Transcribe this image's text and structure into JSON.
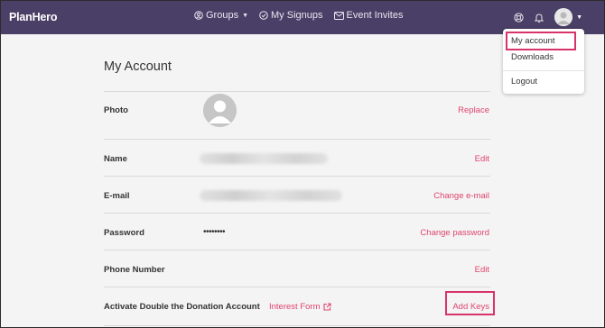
{
  "brand": "PlanHero",
  "nav": {
    "groups": "Groups",
    "signups": "My Signups",
    "invites": "Event Invites"
  },
  "account_menu": {
    "my_account": "My account",
    "downloads": "Downloads",
    "logout": "Logout"
  },
  "page": {
    "title": "My Account",
    "rows": {
      "photo": {
        "label": "Photo",
        "action": "Replace"
      },
      "name": {
        "label": "Name",
        "action": "Edit"
      },
      "email": {
        "label": "E-mail",
        "action": "Change e-mail"
      },
      "password": {
        "label": "Password",
        "value": "••••••••",
        "action": "Change password"
      },
      "phone": {
        "label": "Phone Number",
        "action": "Edit"
      },
      "donation": {
        "label": "Activate Double the Donation Account",
        "link": "Interest Form",
        "action": "Add Keys"
      }
    }
  },
  "colors": {
    "topbar": "#4a3f66",
    "accent": "#e0446e",
    "highlight": "#d8336b"
  }
}
